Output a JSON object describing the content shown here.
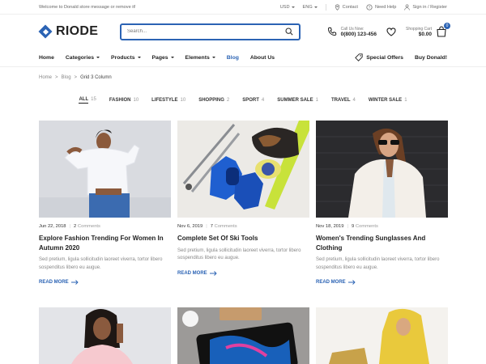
{
  "topbar": {
    "welcome": "Welcome to Donald store message or remove it!",
    "currency": "USD",
    "language": "ENG",
    "contact": "Contact",
    "help": "Need Help",
    "auth": "Sign in / Register"
  },
  "header": {
    "logo": "RIODE",
    "search_placeholder": "Search...",
    "call_label": "Call Us Now:",
    "phone": "0(800) 123-456",
    "cart_label": "Shopping Cart",
    "cart_total": "$0.00",
    "cart_count": "0"
  },
  "nav": {
    "items": [
      {
        "label": "Home"
      },
      {
        "label": "Categories"
      },
      {
        "label": "Products"
      },
      {
        "label": "Pages"
      },
      {
        "label": "Elements"
      },
      {
        "label": "Blog"
      },
      {
        "label": "About Us"
      }
    ],
    "special": "Special Offers",
    "buy": "Buy Donald!"
  },
  "breadcrumb": [
    "Home",
    "Blog",
    "Grid 3 Column"
  ],
  "filters": [
    {
      "label": "ALL",
      "count": "15"
    },
    {
      "label": "FASHION",
      "count": "10"
    },
    {
      "label": "LIFESTYLE",
      "count": "10"
    },
    {
      "label": "SHOPPING",
      "count": "2"
    },
    {
      "label": "SPORT",
      "count": "4"
    },
    {
      "label": "SUMMER SALE",
      "count": "1"
    },
    {
      "label": "TRAVEL",
      "count": "4"
    },
    {
      "label": "WINTER SALE",
      "count": "1"
    }
  ],
  "posts": [
    {
      "date": "Jun 22, 2018",
      "comments_num": "2",
      "comments_word": "Comments",
      "title": "Explore Fashion Trending For Women In Autumn 2020",
      "excerpt": "Sed pretium, ligula sollicitudin laoreet viverra, tortor libero sospenditus libero eu augue.",
      "read_more": "READ MORE"
    },
    {
      "date": "Nov 6, 2019",
      "comments_num": "7",
      "comments_word": "Comments",
      "title": "Complete Set Of Ski Tools",
      "excerpt": "Sed pretium, ligula sollicitudin laoreet viverra, tortor libero sospenditus libero eu augue.",
      "read_more": "READ MORE"
    },
    {
      "date": "Nov 18, 2019",
      "comments_num": "9",
      "comments_word": "Comments",
      "title": "Women's Trending Sunglasses And Clothing",
      "excerpt": "Sed pretium, ligula sollicitudin laoreet viverra, tortor libero sospenditus libero eu augue.",
      "read_more": "READ MORE"
    }
  ],
  "colors": {
    "accent": "#2b63b4"
  }
}
